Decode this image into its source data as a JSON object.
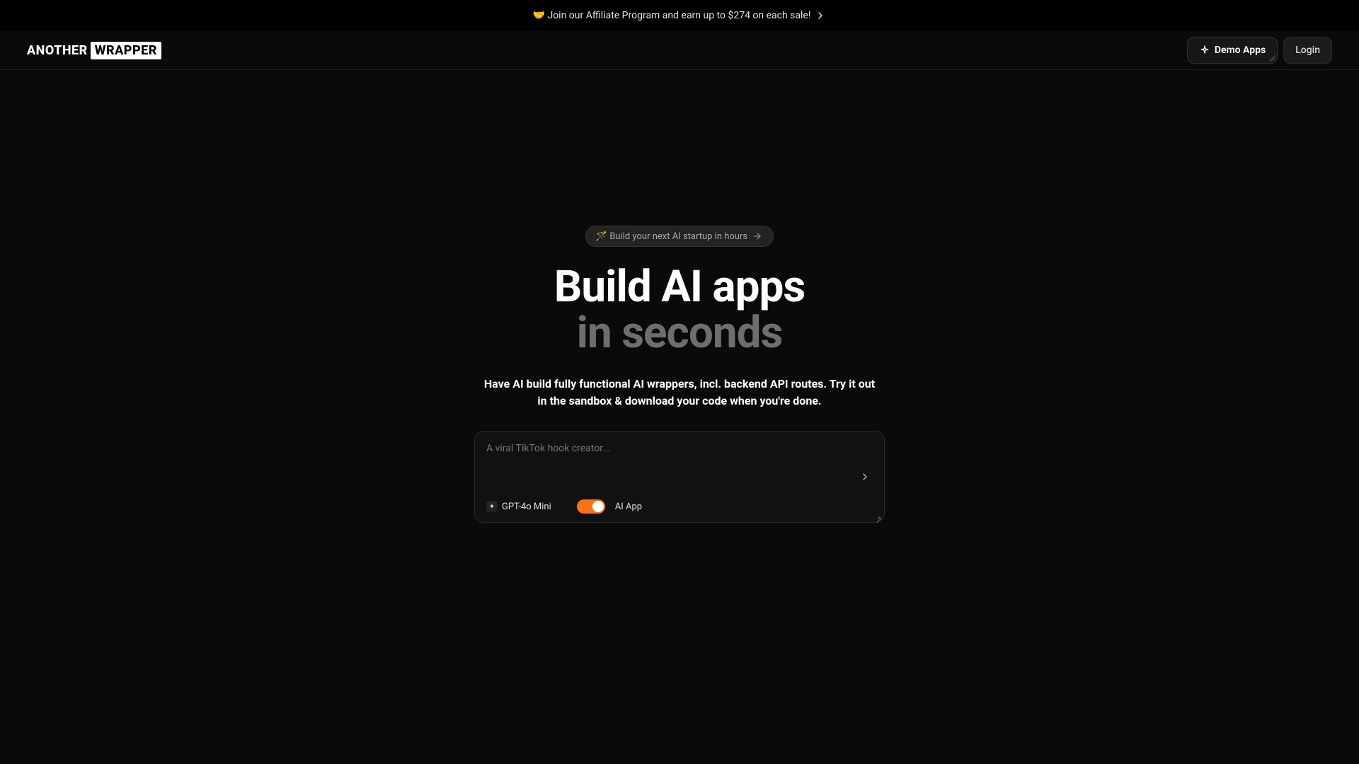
{
  "announce": {
    "text": "🤝 Join our Affiliate Program and earn up to $274 on each sale!"
  },
  "logo": {
    "left": "ANOTHER",
    "right": "WRAPPER"
  },
  "header": {
    "demo_label": "Demo Apps",
    "login_label": "Login"
  },
  "pill": {
    "text": "🪄 Build your next AI startup in hours"
  },
  "hero": {
    "title_line1": "Build AI apps",
    "title_line2": "in seconds",
    "subtitle": "Have AI build fully functional AI wrappers, incl. backend API routes. Try it out in the sandbox & download your code when you're done."
  },
  "prompt": {
    "placeholder": "A viral TikTok hook creator...",
    "model": "GPT-4o Mini",
    "toggle_label": "AI App",
    "toggle_on": true
  },
  "colors": {
    "accent": "#f97316"
  }
}
